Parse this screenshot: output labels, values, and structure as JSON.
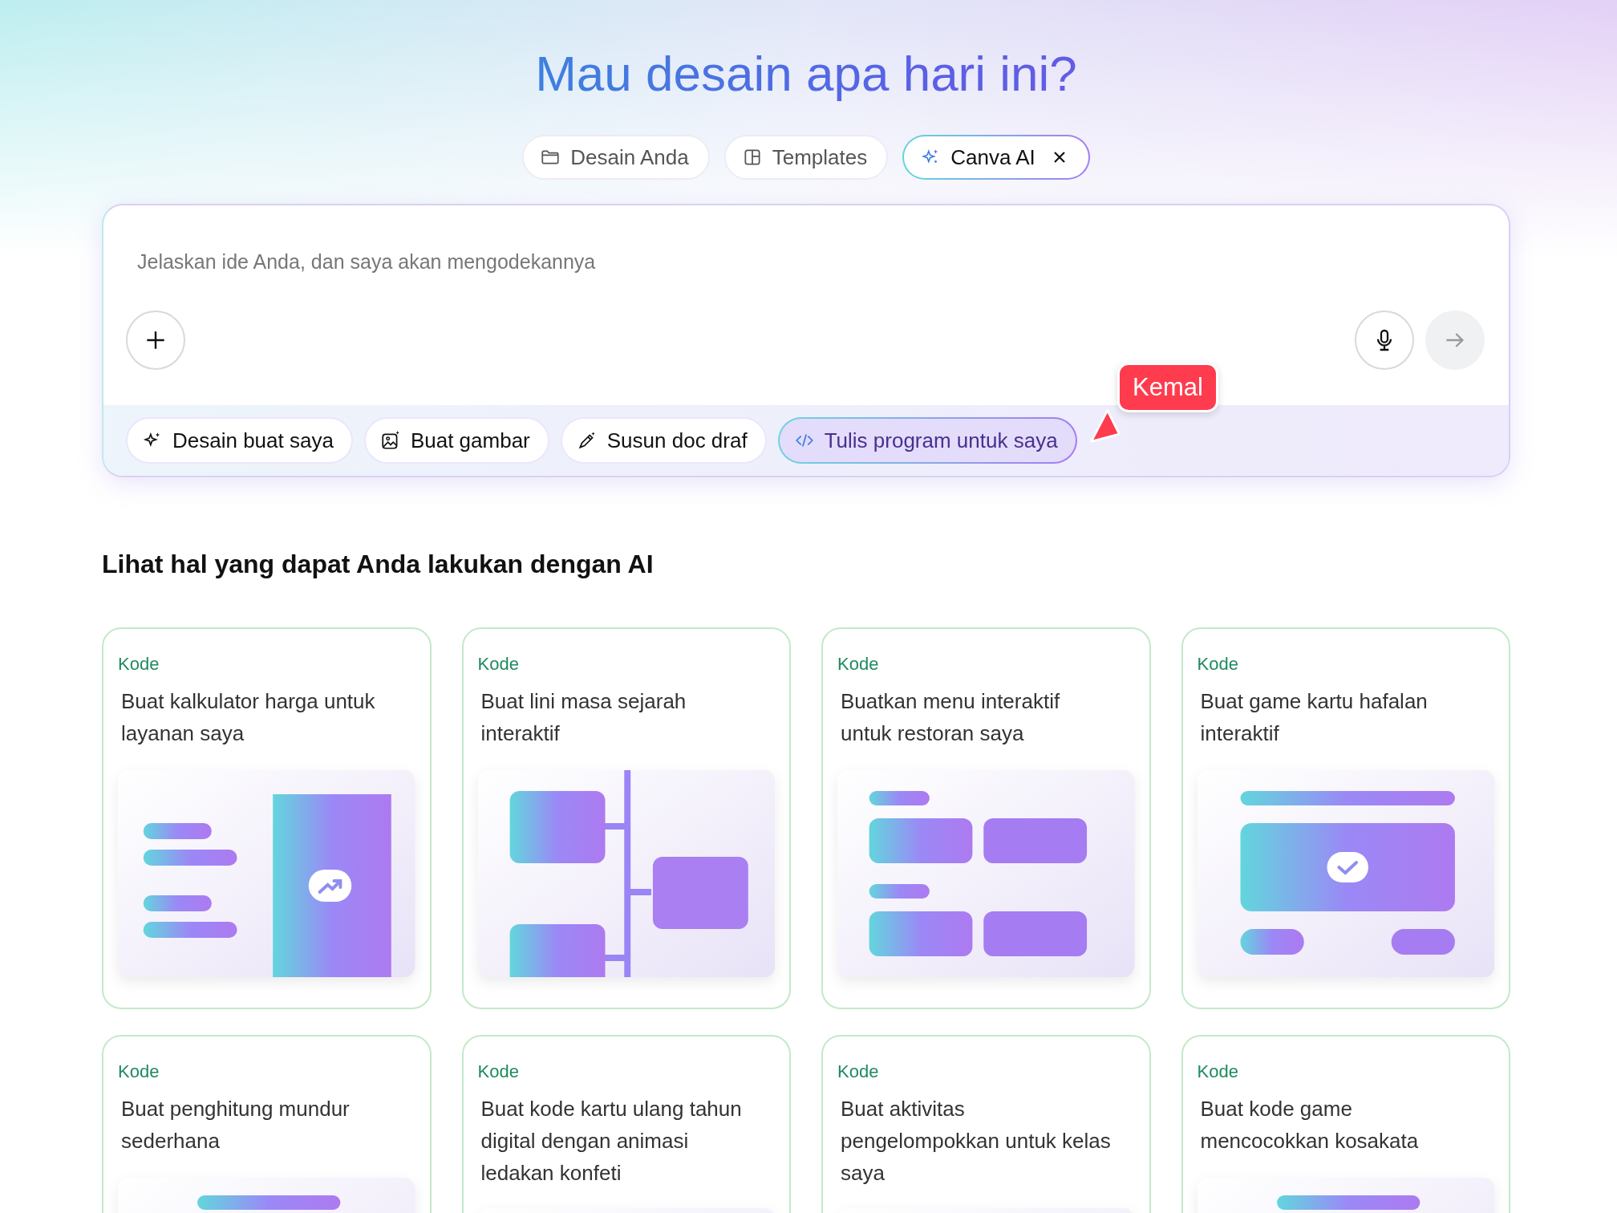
{
  "title": "Mau desain apa hari ini?",
  "tabs": [
    {
      "label": "Desain Anda",
      "kind": "folder",
      "selected": false
    },
    {
      "label": "Templates",
      "kind": "template",
      "selected": false
    },
    {
      "label": "Canva AI",
      "kind": "sparkle",
      "selected": true,
      "closable": true
    }
  ],
  "prompt": {
    "placeholder": "Jelaskan ide Anda, dan saya akan mengodekannya",
    "cursor_tag": "Kemal",
    "chips": [
      {
        "label": "Desain buat saya",
        "kind": "sparkle",
        "selected": false
      },
      {
        "label": "Buat gambar",
        "kind": "image",
        "selected": false
      },
      {
        "label": "Susun doc draf",
        "kind": "pen",
        "selected": false
      },
      {
        "label": "Tulis program untuk saya",
        "kind": "code",
        "selected": true
      }
    ]
  },
  "section_title": "Lihat hal yang dapat Anda lakukan dengan AI",
  "cards": [
    {
      "tag": "Kode",
      "text": "Buat kalkulator harga untuk layanan saya",
      "kind": "calculator"
    },
    {
      "tag": "Kode",
      "text": "Buat lini masa sejarah interaktif",
      "kind": "timeline"
    },
    {
      "tag": "Kode",
      "text": "Buatkan menu interaktif untuk restoran saya",
      "kind": "menu"
    },
    {
      "tag": "Kode",
      "text": "Buat game kartu hafalan interaktif",
      "kind": "flashcard"
    },
    {
      "tag": "Kode",
      "text": "Buat penghitung mundur sederhana",
      "kind": "countdown"
    },
    {
      "tag": "Kode",
      "text": "Buat kode kartu ulang tahun digital dengan animasi ledakan konfeti",
      "kind": "birthday"
    },
    {
      "tag": "Kode",
      "text": "Buat aktivitas pengelompokkan untuk kelas saya",
      "kind": "grouping"
    },
    {
      "tag": "Kode",
      "text": "Buat kode game mencocokkan kosakata",
      "kind": "vocabulary"
    }
  ]
}
